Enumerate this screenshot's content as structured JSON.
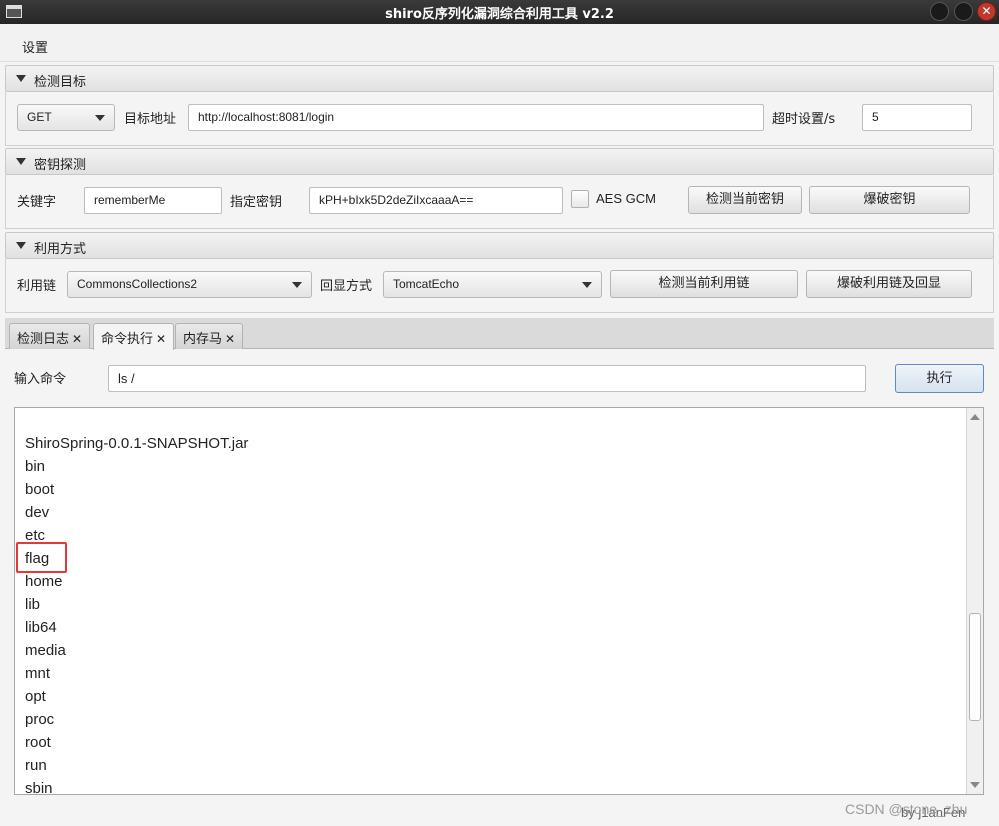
{
  "window": {
    "title": "shiro反序列化漏洞综合利用工具 v2.2",
    "close_glyph": "✕"
  },
  "menubar": {
    "items": [
      "设置"
    ]
  },
  "target_section": {
    "title": "检测目标",
    "method": "GET",
    "url_label": "目标地址",
    "url_value": "http://localhost:8081/login",
    "timeout_label": "超时设置/s",
    "timeout_value": "5"
  },
  "key_section": {
    "title": "密钥探测",
    "keyword_label": "关键字",
    "keyword_value": "rememberMe",
    "key_label": "指定密钥",
    "key_value": "kPH+bIxk5D2deZiIxcaaaA==",
    "aes_gcm_label": "AES GCM",
    "aes_gcm_checked": false,
    "check_key_button": "检测当前密钥",
    "brute_key_button": "爆破密钥"
  },
  "exploit_section": {
    "title": "利用方式",
    "chain_label": "利用链",
    "chain_value": "CommonsCollections2",
    "echo_label": "回显方式",
    "echo_value": "TomcatEcho",
    "check_chain_button": "检测当前利用链",
    "brute_chain_button": "爆破利用链及回显"
  },
  "tabs": [
    {
      "label": "检测日志",
      "active": false
    },
    {
      "label": "命令执行",
      "active": true
    },
    {
      "label": "内存马",
      "active": false
    }
  ],
  "tab_close_glyph": "✕",
  "command": {
    "input_label": "输入命令",
    "input_value": "ls /",
    "execute_button": "执行"
  },
  "output": {
    "lines": [
      "ShiroSpring-0.0.1-SNAPSHOT.jar",
      "bin",
      "boot",
      "dev",
      "etc",
      "flag",
      "home",
      "lib",
      "lib64",
      "media",
      "mnt",
      "opt",
      "proc",
      "root",
      "run",
      "sbin"
    ],
    "highlighted_line": "flag",
    "highlight_color": "#e53935"
  },
  "footer": {
    "credit": "by   j1anFen"
  },
  "watermark": "CSDN @stone_zhu"
}
